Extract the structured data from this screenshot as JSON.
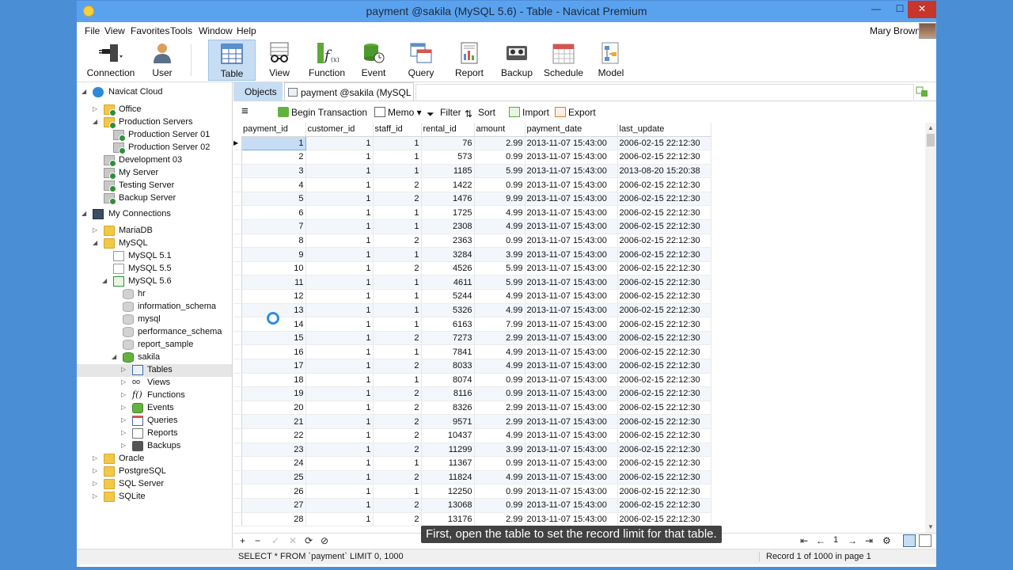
{
  "window": {
    "title": "payment @sakila (MySQL 5.6) - Table - Navicat Premium",
    "controls": {
      "minimize": "—",
      "maximize": "☐",
      "close": "✕"
    }
  },
  "menu": [
    "File",
    "View",
    "Favorites",
    "Tools",
    "Window",
    "Help"
  ],
  "user": {
    "name": "Mary Brown"
  },
  "toolbar": [
    {
      "label": "Connection",
      "icon": "connection-icon"
    },
    {
      "label": "User",
      "icon": "user-icon"
    },
    {
      "label": "Table",
      "icon": "table-icon",
      "active": true
    },
    {
      "label": "View",
      "icon": "view-icon"
    },
    {
      "label": "Function",
      "icon": "function-icon"
    },
    {
      "label": "Event",
      "icon": "event-icon"
    },
    {
      "label": "Query",
      "icon": "query-icon"
    },
    {
      "label": "Report",
      "icon": "report-icon"
    },
    {
      "label": "Backup",
      "icon": "backup-icon"
    },
    {
      "label": "Schedule",
      "icon": "schedule-icon"
    },
    {
      "label": "Model",
      "icon": "model-icon"
    }
  ],
  "tree": [
    {
      "label": "Navicat Cloud",
      "level": 0,
      "icon": "cloud-icon",
      "expanded": true
    },
    {
      "label": "Office",
      "level": 1,
      "icon": "project-folder-icon"
    },
    {
      "label": "Production Servers",
      "level": 1,
      "icon": "project-folder-icon",
      "expanded": true
    },
    {
      "label": "Production Server 01",
      "level": 2,
      "icon": "cloud-server-icon"
    },
    {
      "label": "Production Server 02",
      "level": 2,
      "icon": "cloud-server-icon"
    },
    {
      "label": "Development 03",
      "level": 1,
      "icon": "cloud-server-icon"
    },
    {
      "label": "My Server",
      "level": 1,
      "icon": "cloud-server-icon"
    },
    {
      "label": "Testing Server",
      "level": 1,
      "icon": "cloud-server-icon"
    },
    {
      "label": "Backup Server",
      "level": 1,
      "icon": "cloud-server-icon"
    },
    {
      "label": "My Connections",
      "level": 0,
      "icon": "monitor-icon",
      "expanded": true
    },
    {
      "label": "MariaDB",
      "level": 1,
      "icon": "folder-icon"
    },
    {
      "label": "MySQL",
      "level": 1,
      "icon": "folder-icon",
      "expanded": true
    },
    {
      "label": "MySQL 5.1",
      "level": 2,
      "icon": "mysql-connection-icon"
    },
    {
      "label": "MySQL 5.5",
      "level": 2,
      "icon": "mysql-connection-icon"
    },
    {
      "label": "MySQL 5.6",
      "level": 2,
      "icon": "mysql-connection-open-icon",
      "expanded": true
    },
    {
      "label": "hr",
      "level": 3,
      "icon": "database-icon"
    },
    {
      "label": "information_schema",
      "level": 3,
      "icon": "database-icon"
    },
    {
      "label": "mysql",
      "level": 3,
      "icon": "database-icon"
    },
    {
      "label": "performance_schema",
      "level": 3,
      "icon": "database-icon"
    },
    {
      "label": "report_sample",
      "level": 3,
      "icon": "database-icon"
    },
    {
      "label": "sakila",
      "level": 3,
      "icon": "database-open-icon",
      "expanded": true
    },
    {
      "label": "Tables",
      "level": 4,
      "icon": "tables-icon",
      "selected": true
    },
    {
      "label": "Views",
      "level": 4,
      "icon": "views-icon"
    },
    {
      "label": "Functions",
      "level": 4,
      "icon": "functions-icon"
    },
    {
      "label": "Events",
      "level": 4,
      "icon": "events-icon"
    },
    {
      "label": "Queries",
      "level": 4,
      "icon": "queries-icon"
    },
    {
      "label": "Reports",
      "level": 4,
      "icon": "reports-icon"
    },
    {
      "label": "Backups",
      "level": 4,
      "icon": "backups-icon"
    },
    {
      "label": "Oracle",
      "level": 1,
      "icon": "folder-icon"
    },
    {
      "label": "PostgreSQL",
      "level": 1,
      "icon": "folder-icon"
    },
    {
      "label": "SQL Server",
      "level": 1,
      "icon": "folder-icon"
    },
    {
      "label": "SQLite",
      "level": 1,
      "icon": "folder-icon"
    }
  ],
  "tabs": {
    "objects": "Objects",
    "document": "payment @sakila (MySQL 5.6) ..."
  },
  "gridbar": {
    "menu_icon": "≡",
    "begin_transaction": "Begin Transaction",
    "memo": "Memo",
    "filter": "Filter",
    "sort": "Sort",
    "import": "Import",
    "export": "Export"
  },
  "columns": [
    "payment_id",
    "customer_id",
    "staff_id",
    "rental_id",
    "amount",
    "payment_date",
    "last_update"
  ],
  "rows": [
    [
      "1",
      "1",
      "1",
      "76",
      "2.99",
      "2013-11-07 15:43:00",
      "2006-02-15 22:12:30"
    ],
    [
      "2",
      "1",
      "1",
      "573",
      "0.99",
      "2013-11-07 15:43:00",
      "2006-02-15 22:12:30"
    ],
    [
      "3",
      "1",
      "1",
      "1185",
      "5.99",
      "2013-11-07 15:43:00",
      "2013-08-20 15:20:38"
    ],
    [
      "4",
      "1",
      "2",
      "1422",
      "0.99",
      "2013-11-07 15:43:00",
      "2006-02-15 22:12:30"
    ],
    [
      "5",
      "1",
      "2",
      "1476",
      "9.99",
      "2013-11-07 15:43:00",
      "2006-02-15 22:12:30"
    ],
    [
      "6",
      "1",
      "1",
      "1725",
      "4.99",
      "2013-11-07 15:43:00",
      "2006-02-15 22:12:30"
    ],
    [
      "7",
      "1",
      "1",
      "2308",
      "4.99",
      "2013-11-07 15:43:00",
      "2006-02-15 22:12:30"
    ],
    [
      "8",
      "1",
      "2",
      "2363",
      "0.99",
      "2013-11-07 15:43:00",
      "2006-02-15 22:12:30"
    ],
    [
      "9",
      "1",
      "1",
      "3284",
      "3.99",
      "2013-11-07 15:43:00",
      "2006-02-15 22:12:30"
    ],
    [
      "10",
      "1",
      "2",
      "4526",
      "5.99",
      "2013-11-07 15:43:00",
      "2006-02-15 22:12:30"
    ],
    [
      "11",
      "1",
      "1",
      "4611",
      "5.99",
      "2013-11-07 15:43:00",
      "2006-02-15 22:12:30"
    ],
    [
      "12",
      "1",
      "1",
      "5244",
      "4.99",
      "2013-11-07 15:43:00",
      "2006-02-15 22:12:30"
    ],
    [
      "13",
      "1",
      "1",
      "5326",
      "4.99",
      "2013-11-07 15:43:00",
      "2006-02-15 22:12:30"
    ],
    [
      "14",
      "1",
      "1",
      "6163",
      "7.99",
      "2013-11-07 15:43:00",
      "2006-02-15 22:12:30"
    ],
    [
      "15",
      "1",
      "2",
      "7273",
      "2.99",
      "2013-11-07 15:43:00",
      "2006-02-15 22:12:30"
    ],
    [
      "16",
      "1",
      "1",
      "7841",
      "4.99",
      "2013-11-07 15:43:00",
      "2006-02-15 22:12:30"
    ],
    [
      "17",
      "1",
      "2",
      "8033",
      "4.99",
      "2013-11-07 15:43:00",
      "2006-02-15 22:12:30"
    ],
    [
      "18",
      "1",
      "1",
      "8074",
      "0.99",
      "2013-11-07 15:43:00",
      "2006-02-15 22:12:30"
    ],
    [
      "19",
      "1",
      "2",
      "8116",
      "0.99",
      "2013-11-07 15:43:00",
      "2006-02-15 22:12:30"
    ],
    [
      "20",
      "1",
      "2",
      "8326",
      "2.99",
      "2013-11-07 15:43:00",
      "2006-02-15 22:12:30"
    ],
    [
      "21",
      "1",
      "2",
      "9571",
      "2.99",
      "2013-11-07 15:43:00",
      "2006-02-15 22:12:30"
    ],
    [
      "22",
      "1",
      "2",
      "10437",
      "4.99",
      "2013-11-07 15:43:00",
      "2006-02-15 22:12:30"
    ],
    [
      "23",
      "1",
      "2",
      "11299",
      "3.99",
      "2013-11-07 15:43:00",
      "2006-02-15 22:12:30"
    ],
    [
      "24",
      "1",
      "1",
      "11367",
      "0.99",
      "2013-11-07 15:43:00",
      "2006-02-15 22:12:30"
    ],
    [
      "25",
      "1",
      "2",
      "11824",
      "4.99",
      "2013-11-07 15:43:00",
      "2006-02-15 22:12:30"
    ],
    [
      "26",
      "1",
      "1",
      "12250",
      "0.99",
      "2013-11-07 15:43:00",
      "2006-02-15 22:12:30"
    ],
    [
      "27",
      "1",
      "2",
      "13068",
      "0.99",
      "2013-11-07 15:43:00",
      "2006-02-15 22:12:30"
    ],
    [
      "28",
      "1",
      "2",
      "13176",
      "2.99",
      "2013-11-07 15:43:00",
      "2006-02-15 22:12:30"
    ]
  ],
  "navbar": {
    "add": "+",
    "delete": "−",
    "apply": "✓",
    "discard": "✕",
    "refresh": "⟳",
    "stop": "⊘",
    "first": "⇤",
    "prev": "←",
    "page": "1",
    "next": "→",
    "last": "⇥",
    "settings": "⚙"
  },
  "status": {
    "sql": "SELECT * FROM `payment` LIMIT 0, 1000",
    "record": "Record 1 of 1000 in page 1"
  },
  "caption": "First, open the table to set the record limit for that table.",
  "colors": {
    "accent": "#5aa2ee",
    "selection": "#c6ddf4",
    "desktop": "#4a8fd6"
  }
}
